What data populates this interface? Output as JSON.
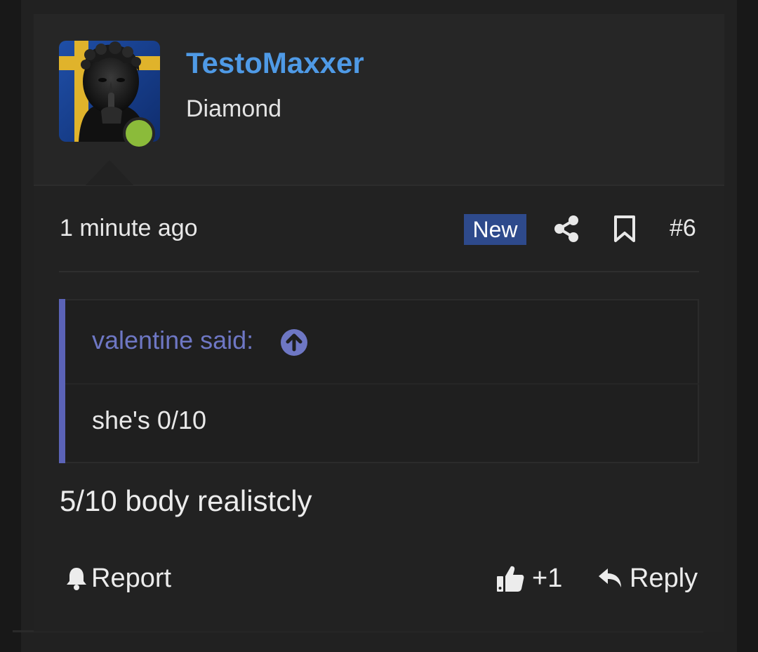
{
  "post": {
    "author": {
      "username": "TestoMaxxer",
      "title": "Diamond",
      "online": true,
      "username_color": "#4f9ae6"
    },
    "meta": {
      "timestamp": "1 minute ago",
      "badge": "New",
      "post_number": "#6",
      "icons": [
        "share-icon",
        "bookmark-icon"
      ]
    },
    "quote": {
      "author_label": "valentine said:",
      "text": "she's 0/10",
      "accent_color": "#5b63b7"
    },
    "body": "5/10 body realistcly",
    "actions": {
      "report_label": "Report",
      "reaction_count": "+1",
      "reply_label": "Reply"
    }
  }
}
